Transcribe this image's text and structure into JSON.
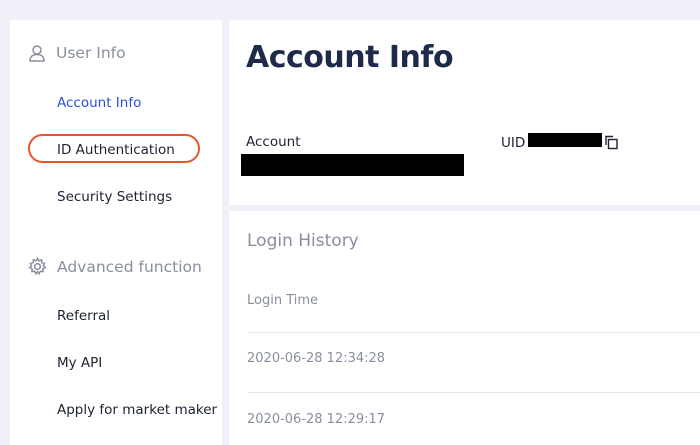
{
  "sidebar": {
    "user_info_header": "User Info",
    "user_info_items": [
      {
        "label": "Account Info",
        "active": true
      },
      {
        "label": "ID Authentication",
        "highlighted": true
      },
      {
        "label": "Security Settings"
      }
    ],
    "advanced_header": "Advanced function",
    "advanced_items": [
      {
        "label": "Referral"
      },
      {
        "label": "My API"
      },
      {
        "label": "Apply for market maker"
      }
    ]
  },
  "account": {
    "title": "Account Info",
    "account_label": "Account",
    "uid_label": "UID"
  },
  "login_history": {
    "title": "Login History",
    "column_header": "Login Time",
    "rows": [
      "2020-06-28 12:34:28",
      "2020-06-28 12:29:17"
    ]
  },
  "colors": {
    "accent": "#2d4fd8",
    "highlight_ring": "#e8562e",
    "background": "#eff0f8"
  },
  "icons": [
    "user-icon",
    "gear-icon",
    "copy-icon"
  ]
}
